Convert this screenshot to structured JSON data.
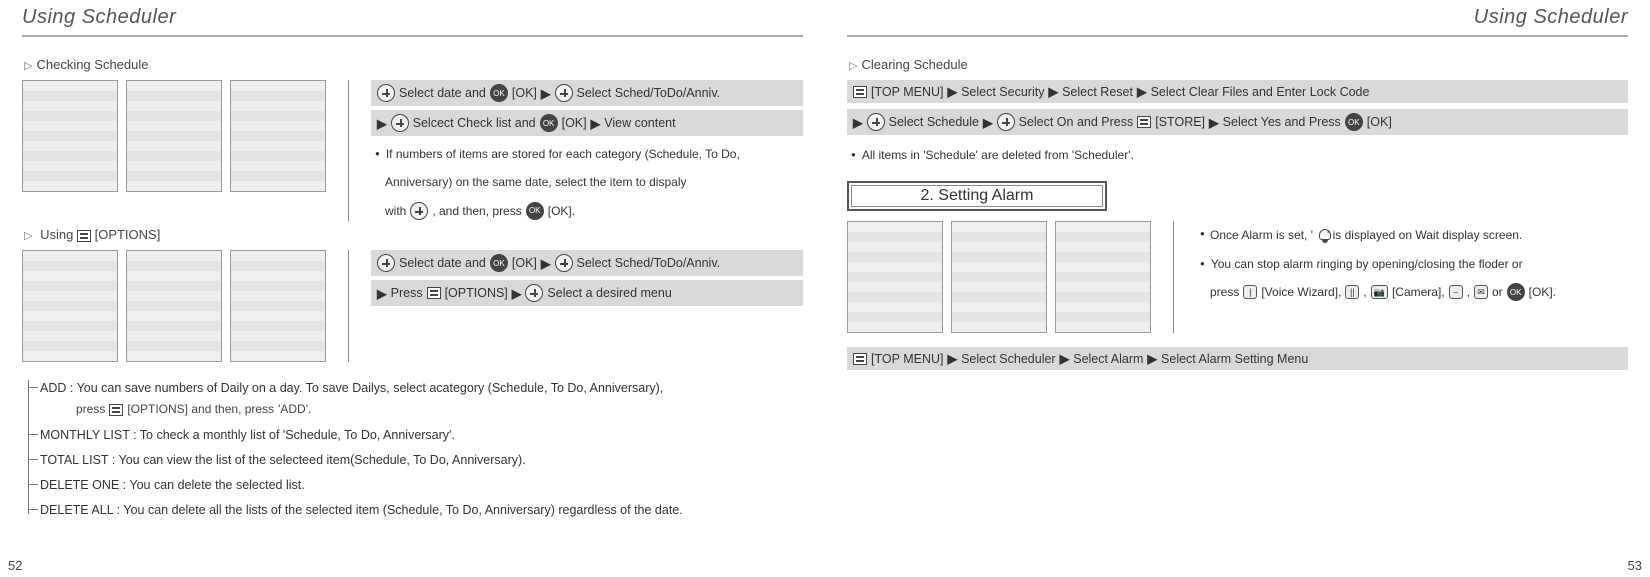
{
  "left": {
    "header": "Using Scheduler",
    "page_num": "52",
    "check": {
      "title": "Checking Schedule",
      "strip1_parts": {
        "a": "Select date and",
        "ok1": "[OK]",
        "b": "Select Sched/ToDo/Anniv."
      },
      "strip2_parts": {
        "a": "Selcect Check list and",
        "ok": "[OK]",
        "b": "View content"
      },
      "note_a": "If numbers of items are stored for each category (Schedule, To Do,",
      "note_b": "Anniversary) on the same date, select the item to dispaly",
      "note_c": "with",
      "note_d": ", and then, press",
      "note_e": "[OK]."
    },
    "options": {
      "title_pre": "Using",
      "title_post": "[OPTIONS]",
      "strip1_parts": {
        "a": "Select date and",
        "ok": "[OK]",
        "b": "Select Sched/ToDo/Anniv."
      },
      "strip2_parts": {
        "a": "Press",
        "opt": "[OPTIONS]",
        "b": "Select a desired menu"
      }
    },
    "tree": {
      "add_a": "ADD : You can save numbers of Daily on a day. To save Dailys, select acategory (Schedule, To Do, Anniversary),",
      "add_b_pre": "press",
      "add_b_opt": "[OPTIONS] and then, press",
      "add_b_post": "'ADD'.",
      "monthly": "MONTHLY LIST : To check a monthly list of 'Schedule, To Do, Anniversary'.",
      "total": "TOTAL LIST : You can view the list of the selecteed item(Schedule, To Do, Anniversary).",
      "del_one": "DELETE ONE : You can delete the selected list.",
      "del_all": "DELETE ALL : You can delete all the lists of the selected item (Schedule, To Do, Anniversary) regardless of the date."
    }
  },
  "right": {
    "header": "Using Scheduler",
    "page_num": "53",
    "clear": {
      "title": "Clearing Schedule",
      "strip1_parts": {
        "a": "[TOP MENU]",
        "b": "Select Security",
        "c": "Select Reset",
        "d": "Select Clear Files and Enter Lock Code"
      },
      "strip2_parts": {
        "a": "Select Schedule",
        "b": "Select On and Press",
        "store": "[STORE]",
        "c": "Select Yes and Press",
        "ok": "[OK]"
      },
      "note": "All items in 'Schedule' are deleted from 'Scheduler'."
    },
    "alarm": {
      "header": "2. Setting Alarm",
      "note1_a": "Once Alarm is set, '",
      "note1_b": "' is displayed on Wait display screen.",
      "note2_a": "You can stop alarm ringing by opening/closing the floder or",
      "note2_b": "press",
      "vw": "[Voice Wizard],",
      "cam": "[Camera],",
      "or": "or",
      "ok": "[OK].",
      "strip": {
        "a": "[TOP MENU]",
        "b": "Select Scheduler",
        "c": "Select Alarm",
        "d": "Select Alarm Setting Menu"
      }
    }
  }
}
